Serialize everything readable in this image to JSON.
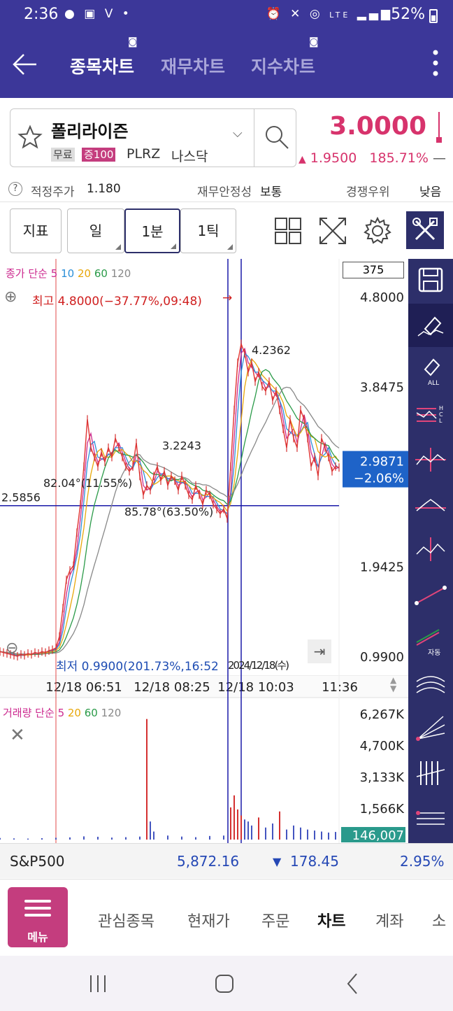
{
  "status_bar": {
    "time": "2:36",
    "battery": "52%",
    "left_icons": [
      "talk-icon",
      "gallery-icon",
      "v-icon",
      "dot-icon"
    ],
    "right_icons": [
      "alarm-icon",
      "mute-icon",
      "hotspot-icon",
      "lte-icon",
      "signal-icon",
      "battery-icon"
    ],
    "lte_label": "LTE"
  },
  "header": {
    "tabs": [
      {
        "label": "종목차트",
        "active": true
      },
      {
        "label": "재무차트",
        "active": false
      },
      {
        "label": "지수차트",
        "active": false
      }
    ]
  },
  "stock": {
    "name": "폴리라이즌",
    "tag_margin": "무료",
    "tag_deposit": "증100",
    "code": "PLRZ",
    "market": "나스닥",
    "price": "3.0000",
    "change_arrow": "▲",
    "change": "1.9500",
    "change_pct": "185.71%",
    "change_tail": "—",
    "price_color": "#d7336c"
  },
  "info": {
    "help": "?",
    "fair_price_label": "적정주가",
    "fair_price": "1.180",
    "stability_label": "재무안정성",
    "stability": "보통",
    "competition_label": "경쟁우위",
    "competition": "낮음"
  },
  "toolbar": {
    "indicator": "지표",
    "period_day": "일",
    "period_min": "1분",
    "period_tick": "1틱"
  },
  "chart_data": {
    "type": "line",
    "title": "",
    "legend_price": {
      "prefix": "종가 단순",
      "periods": [
        "5",
        "10",
        "20",
        "60",
        "120"
      ],
      "colors": [
        "#cc2a8f",
        "#2b8fd8",
        "#e8a70a",
        "#2a9a48",
        "#888888"
      ]
    },
    "legend_volume": {
      "prefix": "거래량 단순",
      "periods": [
        "5",
        "20",
        "60",
        "120"
      ],
      "colors": [
        "#cc2a8f",
        "#e8a70a",
        "#2a9a48",
        "#888888"
      ]
    },
    "count_box": "375",
    "y_ticks": [
      "4.8000",
      "3.8475",
      "1.9425",
      "0.9900"
    ],
    "y_range": [
      0.99,
      4.8
    ],
    "x_ticks": [
      "12/18 06:51",
      "12/18 08:25",
      "12/18 10:03",
      "11:36"
    ],
    "x_overlap_label": "2024/12/18(수)",
    "high_label": "최고 4.8000(−37.77%,09:48)",
    "low_label": "최저 0.9900(201.73%,16:52",
    "annotations": [
      "4.2362",
      "3.2243",
      "82.04°(11.55%)",
      "85.78°(63.50%)",
      "2.5856"
    ],
    "current_price": "2.9871",
    "current_pct": "−2.06%",
    "volume_ticks": [
      "6,267K",
      "4,700K",
      "3,133K",
      "1,566K"
    ],
    "volume_current": "146,007",
    "series": [
      {
        "name": "Close",
        "color": "#e23d3d",
        "x": [
          0,
          5,
          10,
          15,
          20,
          25,
          30,
          35,
          40,
          45,
          50,
          55,
          60,
          65,
          70,
          75,
          80,
          85,
          90,
          95,
          100,
          105,
          110,
          115,
          120,
          125,
          130,
          135,
          140,
          145,
          150,
          155,
          160,
          165,
          170,
          175,
          180,
          185,
          190,
          195,
          200,
          205,
          210,
          215,
          220,
          225,
          230,
          235,
          240,
          245,
          250,
          255,
          260,
          265,
          270,
          275,
          280,
          285,
          290,
          295,
          300,
          305,
          310,
          315,
          320,
          325,
          330,
          335,
          340,
          345,
          350,
          355,
          360,
          365,
          370,
          375,
          380,
          385,
          390,
          395,
          400,
          405,
          410,
          415,
          420,
          425,
          430,
          435,
          440,
          445,
          450,
          455,
          460,
          465,
          470,
          475,
          480,
          485
        ],
        "y": [
          1.04,
          1.03,
          1.02,
          1.01,
          1.0,
          0.99,
          1.01,
          1.0,
          1.02,
          1.01,
          1.03,
          1.02,
          1.04,
          1.03,
          1.05,
          1.06,
          1.08,
          1.2,
          1.5,
          1.8,
          1.9,
          1.95,
          2.3,
          2.6,
          3.0,
          3.5,
          3.2,
          3.1,
          3.0,
          3.15,
          3.05,
          3.2,
          3.1,
          3.3,
          3.2,
          3.1,
          3.0,
          2.95,
          3.0,
          3.25,
          2.9,
          2.7,
          2.8,
          2.75,
          2.9,
          3.0,
          2.85,
          2.95,
          2.8,
          2.9,
          2.85,
          2.75,
          2.9,
          2.8,
          2.7,
          2.65,
          2.8,
          2.7,
          2.6,
          2.75,
          2.7,
          2.6,
          2.55,
          2.5,
          2.55,
          2.45,
          3.0,
          3.6,
          4.1,
          4.3,
          4.2,
          4.0,
          4.1,
          3.9,
          4.0,
          3.85,
          3.8,
          3.9,
          3.7,
          3.8,
          3.6,
          3.4,
          3.2,
          3.5,
          3.3,
          3.2,
          3.6,
          3.5,
          3.3,
          3.0,
          3.1,
          2.9,
          3.3,
          3.2,
          3.1,
          2.95,
          3.0,
          2.99
        ]
      }
    ],
    "volume": {
      "x": [
        0,
        20,
        40,
        60,
        80,
        100,
        120,
        140,
        160,
        180,
        200,
        210,
        215,
        220,
        240,
        260,
        280,
        300,
        320,
        330,
        335,
        340,
        345,
        350,
        355,
        360,
        370,
        380,
        390,
        400,
        410,
        420,
        430,
        440,
        450,
        460,
        470,
        480
      ],
      "values": [
        80,
        60,
        50,
        70,
        90,
        110,
        160,
        140,
        100,
        120,
        150,
        6000,
        900,
        400,
        200,
        150,
        120,
        180,
        200,
        1600,
        2200,
        1500,
        1200,
        1000,
        900,
        700,
        1100,
        600,
        800,
        1400,
        500,
        700,
        600,
        500,
        450,
        400,
        350,
        380
      ]
    }
  },
  "ticker": {
    "name": "S&P500",
    "value": "5,872.16",
    "arrow": "▼",
    "change": "178.45",
    "pct": "2.95%"
  },
  "bottom_nav": {
    "menu": "메뉴",
    "items": [
      {
        "label": "관심종목",
        "active": false
      },
      {
        "label": "현재가",
        "active": false
      },
      {
        "label": "주문",
        "active": false
      },
      {
        "label": "차트",
        "active": true
      },
      {
        "label": "계좌",
        "active": false
      },
      {
        "label": "소",
        "active": false
      }
    ]
  },
  "right_panel": {
    "items": [
      "save-icon",
      "eraser-icon",
      "eraser-all-icon",
      "hcl-icon",
      "trend-cross-icon",
      "peak-icon",
      "zigzag-icon",
      "trendline-icon",
      "auto-trend-icon",
      "arc-icon",
      "fan-icon",
      "gann-icon",
      "channel-icon"
    ],
    "eraser_all_label": "ALL",
    "hcl_letters": [
      "H",
      "C",
      "L"
    ],
    "auto_label": "자동"
  }
}
